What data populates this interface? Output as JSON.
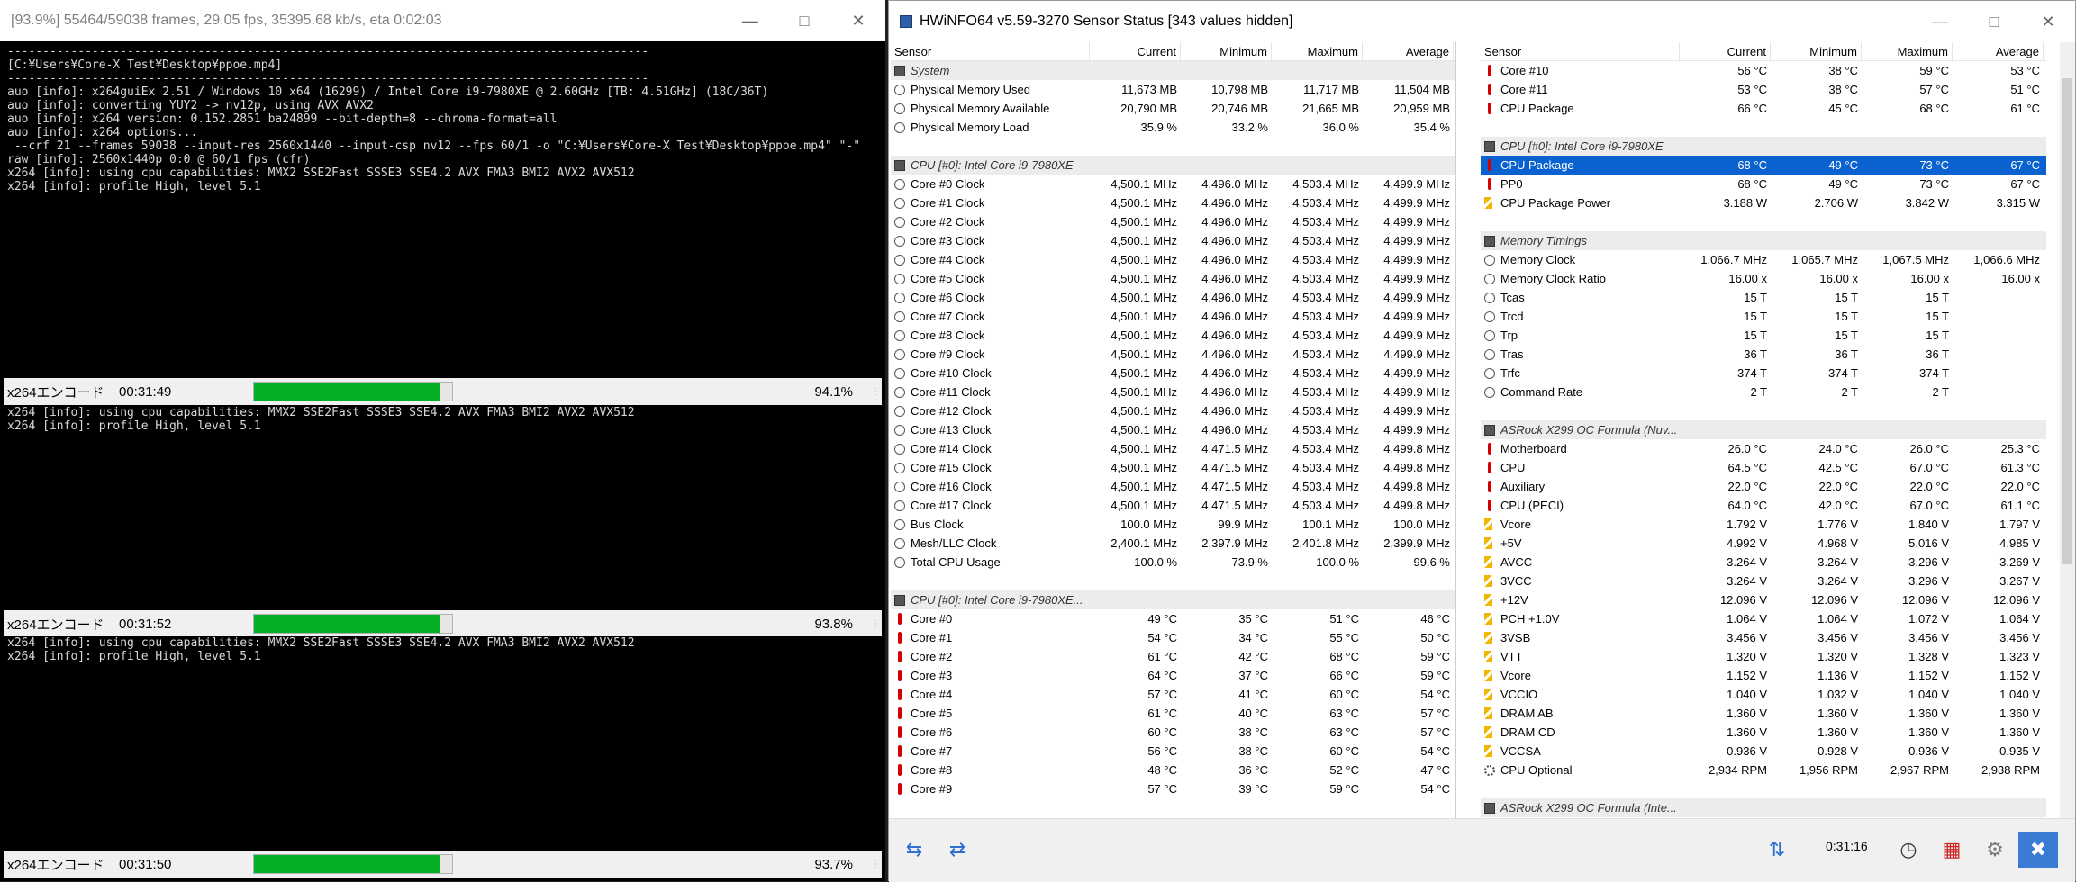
{
  "terminal": {
    "title": "[93.9%] 55464/59038 frames, 29.05 fps, 35395.68 kb/s, eta 0:02:03",
    "pane1_lines": [
      "-------------------------------------------------------------------------------------------",
      "[C:¥Users¥Core-X Test¥Desktop¥ppoe.mp4]",
      "-------------------------------------------------------------------------------------------",
      "auo [info]: x264guiEx 2.51 / Windows 10 x64 (16299) / Intel Core i9-7980XE @ 2.60GHz [TB: 4.51GHz] (18C/36T)",
      "auo [info]: converting YUY2 -> nv12p, using AVX AVX2",
      "auo [info]: x264 version: 0.152.2851 ba24899 --bit-depth=8 --chroma-format=all",
      "auo [info]: x264 options...",
      " --crf 21 --frames 59038 --input-res 2560x1440 --input-csp nv12 --fps 60/1 -o \"C:¥Users¥Core-X Test¥Desktop¥ppoe.mp4\" \"-\"",
      "raw [info]: 2560x1440p 0:0 @ 60/1 fps (cfr)",
      "x264 [info]: using cpu capabilities: MMX2 SSE2Fast SSSE3 SSE4.2 AVX FMA3 BMI2 AVX2 AVX512",
      "x264 [info]: profile High, level 5.1"
    ],
    "pane2_lines": [
      "x264 [info]: using cpu capabilities: MMX2 SSE2Fast SSSE3 SSE4.2 AVX FMA3 BMI2 AVX2 AVX512",
      "x264 [info]: profile High, level 5.1"
    ],
    "pane3_lines": [
      "x264 [info]: using cpu capabilities: MMX2 SSE2Fast SSSE3 SSE4.2 AVX FMA3 BMI2 AVX2 AVX512",
      "x264 [info]: profile High, level 5.1"
    ],
    "status": [
      {
        "label": "x264エンコード",
        "time": "00:31:49",
        "percent": "94.1%",
        "fill": 0.941
      },
      {
        "label": "x264エンコード",
        "time": "00:31:52",
        "percent": "93.8%",
        "fill": 0.938
      },
      {
        "label": "x264エンコード",
        "time": "00:31:50",
        "percent": "93.7%",
        "fill": 0.937
      }
    ]
  },
  "hwinfo": {
    "title": "HWiNFO64 v5.59-3270 Sensor Status [343 values hidden]",
    "headers": [
      "Sensor",
      "Current",
      "Minimum",
      "Maximum",
      "Average"
    ],
    "left_rows": [
      {
        "g": "System",
        "icon": "chip"
      },
      {
        "n": "Physical Memory Used",
        "v": [
          "11,673 MB",
          "10,798 MB",
          "11,717 MB",
          "11,504 MB"
        ],
        "icon": "clock"
      },
      {
        "n": "Physical Memory Available",
        "v": [
          "20,790 MB",
          "20,746 MB",
          "21,665 MB",
          "20,959 MB"
        ],
        "icon": "clock"
      },
      {
        "n": "Physical Memory Load",
        "v": [
          "35.9 %",
          "33.2 %",
          "36.0 %",
          "35.4 %"
        ],
        "icon": "clock"
      },
      {
        "b": 1
      },
      {
        "g": "CPU [#0]: Intel Core i9-7980XE",
        "icon": "chip"
      },
      {
        "n": "Core #0 Clock",
        "v": [
          "4,500.1 MHz",
          "4,496.0 MHz",
          "4,503.4 MHz",
          "4,499.9 MHz"
        ],
        "icon": "clock"
      },
      {
        "n": "Core #1 Clock",
        "v": [
          "4,500.1 MHz",
          "4,496.0 MHz",
          "4,503.4 MHz",
          "4,499.9 MHz"
        ],
        "icon": "clock"
      },
      {
        "n": "Core #2 Clock",
        "v": [
          "4,500.1 MHz",
          "4,496.0 MHz",
          "4,503.4 MHz",
          "4,499.9 MHz"
        ],
        "icon": "clock"
      },
      {
        "n": "Core #3 Clock",
        "v": [
          "4,500.1 MHz",
          "4,496.0 MHz",
          "4,503.4 MHz",
          "4,499.9 MHz"
        ],
        "icon": "clock"
      },
      {
        "n": "Core #4 Clock",
        "v": [
          "4,500.1 MHz",
          "4,496.0 MHz",
          "4,503.4 MHz",
          "4,499.9 MHz"
        ],
        "icon": "clock"
      },
      {
        "n": "Core #5 Clock",
        "v": [
          "4,500.1 MHz",
          "4,496.0 MHz",
          "4,503.4 MHz",
          "4,499.9 MHz"
        ],
        "icon": "clock"
      },
      {
        "n": "Core #6 Clock",
        "v": [
          "4,500.1 MHz",
          "4,496.0 MHz",
          "4,503.4 MHz",
          "4,499.9 MHz"
        ],
        "icon": "clock"
      },
      {
        "n": "Core #7 Clock",
        "v": [
          "4,500.1 MHz",
          "4,496.0 MHz",
          "4,503.4 MHz",
          "4,499.9 MHz"
        ],
        "icon": "clock"
      },
      {
        "n": "Core #8 Clock",
        "v": [
          "4,500.1 MHz",
          "4,496.0 MHz",
          "4,503.4 MHz",
          "4,499.9 MHz"
        ],
        "icon": "clock"
      },
      {
        "n": "Core #9 Clock",
        "v": [
          "4,500.1 MHz",
          "4,496.0 MHz",
          "4,503.4 MHz",
          "4,499.9 MHz"
        ],
        "icon": "clock"
      },
      {
        "n": "Core #10 Clock",
        "v": [
          "4,500.1 MHz",
          "4,496.0 MHz",
          "4,503.4 MHz",
          "4,499.9 MHz"
        ],
        "icon": "clock"
      },
      {
        "n": "Core #11 Clock",
        "v": [
          "4,500.1 MHz",
          "4,496.0 MHz",
          "4,503.4 MHz",
          "4,499.9 MHz"
        ],
        "icon": "clock"
      },
      {
        "n": "Core #12 Clock",
        "v": [
          "4,500.1 MHz",
          "4,496.0 MHz",
          "4,503.4 MHz",
          "4,499.9 MHz"
        ],
        "icon": "clock"
      },
      {
        "n": "Core #13 Clock",
        "v": [
          "4,500.1 MHz",
          "4,496.0 MHz",
          "4,503.4 MHz",
          "4,499.9 MHz"
        ],
        "icon": "clock"
      },
      {
        "n": "Core #14 Clock",
        "v": [
          "4,500.1 MHz",
          "4,471.5 MHz",
          "4,503.4 MHz",
          "4,499.8 MHz"
        ],
        "icon": "clock"
      },
      {
        "n": "Core #15 Clock",
        "v": [
          "4,500.1 MHz",
          "4,471.5 MHz",
          "4,503.4 MHz",
          "4,499.8 MHz"
        ],
        "icon": "clock"
      },
      {
        "n": "Core #16 Clock",
        "v": [
          "4,500.1 MHz",
          "4,471.5 MHz",
          "4,503.4 MHz",
          "4,499.8 MHz"
        ],
        "icon": "clock"
      },
      {
        "n": "Core #17 Clock",
        "v": [
          "4,500.1 MHz",
          "4,471.5 MHz",
          "4,503.4 MHz",
          "4,499.8 MHz"
        ],
        "icon": "clock"
      },
      {
        "n": "Bus Clock",
        "v": [
          "100.0 MHz",
          "99.9 MHz",
          "100.1 MHz",
          "100.0 MHz"
        ],
        "icon": "clock"
      },
      {
        "n": "Mesh/LLC Clock",
        "v": [
          "2,400.1 MHz",
          "2,397.9 MHz",
          "2,401.8 MHz",
          "2,399.9 MHz"
        ],
        "icon": "clock"
      },
      {
        "n": "Total CPU Usage",
        "v": [
          "100.0 %",
          "73.9 %",
          "100.0 %",
          "99.6 %"
        ],
        "icon": "clock"
      },
      {
        "b": 1
      },
      {
        "g": "CPU [#0]: Intel Core i9-7980XE...",
        "icon": "chip"
      },
      {
        "n": "Core #0",
        "v": [
          "49 °C",
          "35 °C",
          "51 °C",
          "46 °C"
        ],
        "icon": "temp"
      },
      {
        "n": "Core #1",
        "v": [
          "54 °C",
          "34 °C",
          "55 °C",
          "50 °C"
        ],
        "icon": "temp"
      },
      {
        "n": "Core #2",
        "v": [
          "61 °C",
          "42 °C",
          "68 °C",
          "59 °C"
        ],
        "icon": "temp"
      },
      {
        "n": "Core #3",
        "v": [
          "64 °C",
          "37 °C",
          "66 °C",
          "59 °C"
        ],
        "icon": "temp"
      },
      {
        "n": "Core #4",
        "v": [
          "57 °C",
          "41 °C",
          "60 °C",
          "54 °C"
        ],
        "icon": "temp"
      },
      {
        "n": "Core #5",
        "v": [
          "61 °C",
          "40 °C",
          "63 °C",
          "57 °C"
        ],
        "icon": "temp"
      },
      {
        "n": "Core #6",
        "v": [
          "60 °C",
          "38 °C",
          "63 °C",
          "57 °C"
        ],
        "icon": "temp"
      },
      {
        "n": "Core #7",
        "v": [
          "56 °C",
          "38 °C",
          "60 °C",
          "54 °C"
        ],
        "icon": "temp"
      },
      {
        "n": "Core #8",
        "v": [
          "48 °C",
          "36 °C",
          "52 °C",
          "47 °C"
        ],
        "icon": "temp"
      },
      {
        "n": "Core #9",
        "v": [
          "57 °C",
          "39 °C",
          "59 °C",
          "54 °C"
        ],
        "icon": "temp"
      }
    ],
    "right_rows": [
      {
        "n": "Core #10",
        "v": [
          "56 °C",
          "38 °C",
          "59 °C",
          "53 °C"
        ],
        "icon": "temp"
      },
      {
        "n": "Core #11",
        "v": [
          "53 °C",
          "38 °C",
          "57 °C",
          "51 °C"
        ],
        "icon": "temp"
      },
      {
        "n": "CPU Package",
        "v": [
          "66 °C",
          "45 °C",
          "68 °C",
          "61 °C"
        ],
        "icon": "temp"
      },
      {
        "b": 1
      },
      {
        "g": "CPU [#0]: Intel Core i9-7980XE",
        "icon": "chip"
      },
      {
        "n": "CPU Package",
        "v": [
          "68 °C",
          "49 °C",
          "73 °C",
          "67 °C"
        ],
        "icon": "temp",
        "sel": 1
      },
      {
        "n": "PP0",
        "v": [
          "68 °C",
          "49 °C",
          "73 °C",
          "67 °C"
        ],
        "icon": "temp"
      },
      {
        "n": "CPU Package Power",
        "v": [
          "3.188 W",
          "2.706 W",
          "3.842 W",
          "3.315 W"
        ],
        "icon": "volt"
      },
      {
        "b": 1
      },
      {
        "g": "Memory Timings",
        "icon": "chip"
      },
      {
        "n": "Memory Clock",
        "v": [
          "1,066.7 MHz",
          "1,065.7 MHz",
          "1,067.5 MHz",
          "1,066.6 MHz"
        ],
        "icon": "clock"
      },
      {
        "n": "Memory Clock Ratio",
        "v": [
          "16.00 x",
          "16.00 x",
          "16.00 x",
          "16.00 x"
        ],
        "icon": "clock"
      },
      {
        "n": "Tcas",
        "v": [
          "15 T",
          "15 T",
          "15 T",
          ""
        ],
        "icon": "clock"
      },
      {
        "n": "Trcd",
        "v": [
          "15 T",
          "15 T",
          "15 T",
          ""
        ],
        "icon": "clock"
      },
      {
        "n": "Trp",
        "v": [
          "15 T",
          "15 T",
          "15 T",
          ""
        ],
        "icon": "clock"
      },
      {
        "n": "Tras",
        "v": [
          "36 T",
          "36 T",
          "36 T",
          ""
        ],
        "icon": "clock"
      },
      {
        "n": "Trfc",
        "v": [
          "374 T",
          "374 T",
          "374 T",
          ""
        ],
        "icon": "clock"
      },
      {
        "n": "Command Rate",
        "v": [
          "2 T",
          "2 T",
          "2 T",
          ""
        ],
        "icon": "clock"
      },
      {
        "b": 1
      },
      {
        "g": "ASRock X299 OC Formula (Nuv...",
        "icon": "chip"
      },
      {
        "n": "Motherboard",
        "v": [
          "26.0 °C",
          "24.0 °C",
          "26.0 °C",
          "25.3 °C"
        ],
        "icon": "temp"
      },
      {
        "n": "CPU",
        "v": [
          "64.5 °C",
          "42.5 °C",
          "67.0 °C",
          "61.3 °C"
        ],
        "icon": "temp"
      },
      {
        "n": "Auxiliary",
        "v": [
          "22.0 °C",
          "22.0 °C",
          "22.0 °C",
          "22.0 °C"
        ],
        "icon": "temp"
      },
      {
        "n": "CPU (PECI)",
        "v": [
          "64.0 °C",
          "42.0 °C",
          "67.0 °C",
          "61.1 °C"
        ],
        "icon": "temp"
      },
      {
        "n": "Vcore",
        "v": [
          "1.792 V",
          "1.776 V",
          "1.840 V",
          "1.797 V"
        ],
        "icon": "volt"
      },
      {
        "n": "+5V",
        "v": [
          "4.992 V",
          "4.968 V",
          "5.016 V",
          "4.985 V"
        ],
        "icon": "volt"
      },
      {
        "n": "AVCC",
        "v": [
          "3.264 V",
          "3.264 V",
          "3.296 V",
          "3.269 V"
        ],
        "icon": "volt"
      },
      {
        "n": "3VCC",
        "v": [
          "3.264 V",
          "3.264 V",
          "3.296 V",
          "3.267 V"
        ],
        "icon": "volt"
      },
      {
        "n": "+12V",
        "v": [
          "12.096 V",
          "12.096 V",
          "12.096 V",
          "12.096 V"
        ],
        "icon": "volt"
      },
      {
        "n": "PCH +1.0V",
        "v": [
          "1.064 V",
          "1.064 V",
          "1.072 V",
          "1.064 V"
        ],
        "icon": "volt"
      },
      {
        "n": "3VSB",
        "v": [
          "3.456 V",
          "3.456 V",
          "3.456 V",
          "3.456 V"
        ],
        "icon": "volt"
      },
      {
        "n": "VTT",
        "v": [
          "1.320 V",
          "1.320 V",
          "1.328 V",
          "1.323 V"
        ],
        "icon": "volt"
      },
      {
        "n": "Vcore",
        "v": [
          "1.152 V",
          "1.136 V",
          "1.152 V",
          "1.152 V"
        ],
        "icon": "volt"
      },
      {
        "n": "VCCIO",
        "v": [
          "1.040 V",
          "1.032 V",
          "1.040 V",
          "1.040 V"
        ],
        "icon": "volt"
      },
      {
        "n": "DRAM AB",
        "v": [
          "1.360 V",
          "1.360 V",
          "1.360 V",
          "1.360 V"
        ],
        "icon": "volt"
      },
      {
        "n": "DRAM CD",
        "v": [
          "1.360 V",
          "1.360 V",
          "1.360 V",
          "1.360 V"
        ],
        "icon": "volt"
      },
      {
        "n": "VCCSA",
        "v": [
          "0.936 V",
          "0.928 V",
          "0.936 V",
          "0.935 V"
        ],
        "icon": "volt"
      },
      {
        "n": "CPU Optional",
        "v": [
          "2,934 RPM",
          "1,956 RPM",
          "2,967 RPM",
          "2,938 RPM"
        ],
        "icon": "fan"
      },
      {
        "b": 1
      },
      {
        "g": "ASRock X299 OC Formula (Inte...",
        "icon": "chip"
      }
    ],
    "footer": {
      "time": "0:31:16"
    }
  }
}
